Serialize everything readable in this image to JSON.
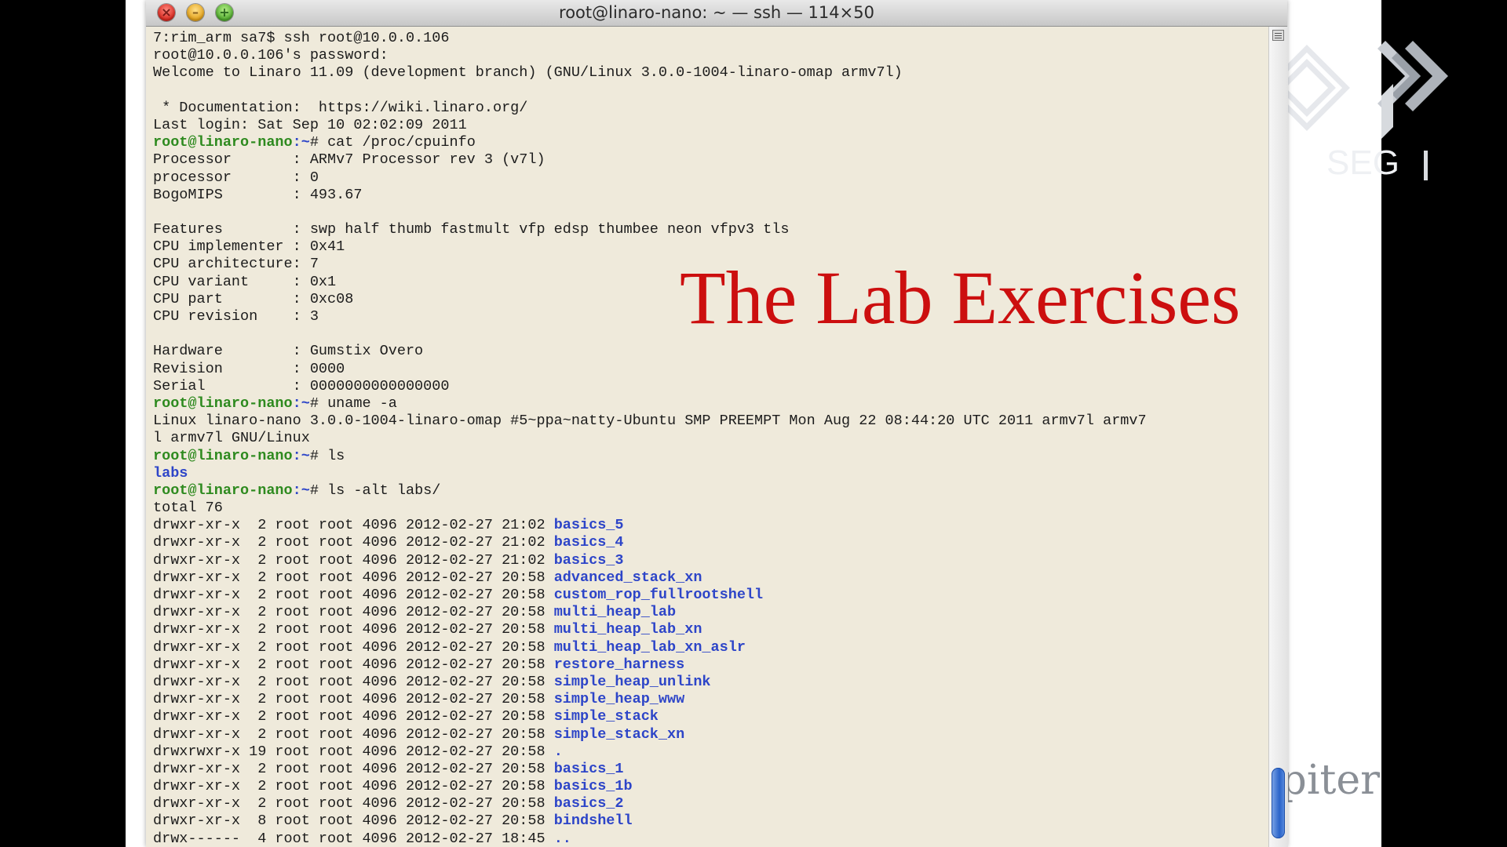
{
  "window": {
    "title": "root@linaro-nano: ~ — ssh — 114×50",
    "buttons": {
      "close": "×",
      "minimize": "–",
      "zoom": "+"
    }
  },
  "overlay": {
    "title": "The Lab Exercises"
  },
  "brand": {
    "footer_text": "piter",
    "logo_icon": "seal-logo-icon"
  },
  "colors": {
    "terminal_bg": "#efeadb",
    "prompt_user": "#2e8a1f",
    "prompt_path": "#2d45c8",
    "directory": "#2d45c8",
    "overlay_title": "#cc0f0f",
    "scroll_thumb": "#2a63c9"
  },
  "terminal": {
    "prompt_user": "root@linaro-nano",
    "prompt_path": ":~",
    "lines": [
      {
        "type": "text",
        "text": "7:rim_arm sa7$ ssh root@10.0.0.106"
      },
      {
        "type": "text",
        "text": "root@10.0.0.106's password:"
      },
      {
        "type": "text",
        "text": "Welcome to Linaro 11.09 (development branch) (GNU/Linux 3.0.0-1004-linaro-omap armv7l)"
      },
      {
        "type": "text",
        "text": ""
      },
      {
        "type": "text",
        "text": " * Documentation:  https://wiki.linaro.org/"
      },
      {
        "type": "text",
        "text": "Last login: Sat Sep 10 02:02:09 2011"
      },
      {
        "type": "cmd",
        "cmd": "# cat /proc/cpuinfo"
      },
      {
        "type": "text",
        "text": "Processor       : ARMv7 Processor rev 3 (v7l)"
      },
      {
        "type": "text",
        "text": "processor       : 0"
      },
      {
        "type": "text",
        "text": "BogoMIPS        : 493.67"
      },
      {
        "type": "text",
        "text": ""
      },
      {
        "type": "text",
        "text": "Features        : swp half thumb fastmult vfp edsp thumbee neon vfpv3 tls"
      },
      {
        "type": "text",
        "text": "CPU implementer : 0x41"
      },
      {
        "type": "text",
        "text": "CPU architecture: 7"
      },
      {
        "type": "text",
        "text": "CPU variant     : 0x1"
      },
      {
        "type": "text",
        "text": "CPU part        : 0xc08"
      },
      {
        "type": "text",
        "text": "CPU revision    : 3"
      },
      {
        "type": "text",
        "text": ""
      },
      {
        "type": "text",
        "text": "Hardware        : Gumstix Overo"
      },
      {
        "type": "text",
        "text": "Revision        : 0000"
      },
      {
        "type": "text",
        "text": "Serial          : 0000000000000000"
      },
      {
        "type": "cmd",
        "cmd": "# uname -a"
      },
      {
        "type": "text",
        "text": "Linux linaro-nano 3.0.0-1004-linaro-omap #5~ppa~natty-Ubuntu SMP PREEMPT Mon Aug 22 08:44:20 UTC 2011 armv7l armv7"
      },
      {
        "type": "text",
        "text": "l armv7l GNU/Linux"
      },
      {
        "type": "cmd",
        "cmd": "# ls"
      },
      {
        "type": "dironly",
        "name": "labs"
      },
      {
        "type": "cmd",
        "cmd": "# ls -alt labs/"
      },
      {
        "type": "text",
        "text": "total 76"
      },
      {
        "type": "entry",
        "perms": "drwxr-xr-x  2 root root 4096 2012-02-27 21:02 ",
        "name": "basics_5"
      },
      {
        "type": "entry",
        "perms": "drwxr-xr-x  2 root root 4096 2012-02-27 21:02 ",
        "name": "basics_4"
      },
      {
        "type": "entry",
        "perms": "drwxr-xr-x  2 root root 4096 2012-02-27 21:02 ",
        "name": "basics_3"
      },
      {
        "type": "entry",
        "perms": "drwxr-xr-x  2 root root 4096 2012-02-27 20:58 ",
        "name": "advanced_stack_xn"
      },
      {
        "type": "entry",
        "perms": "drwxr-xr-x  2 root root 4096 2012-02-27 20:58 ",
        "name": "custom_rop_fullrootshell"
      },
      {
        "type": "entry",
        "perms": "drwxr-xr-x  2 root root 4096 2012-02-27 20:58 ",
        "name": "multi_heap_lab"
      },
      {
        "type": "entry",
        "perms": "drwxr-xr-x  2 root root 4096 2012-02-27 20:58 ",
        "name": "multi_heap_lab_xn"
      },
      {
        "type": "entry",
        "perms": "drwxr-xr-x  2 root root 4096 2012-02-27 20:58 ",
        "name": "multi_heap_lab_xn_aslr"
      },
      {
        "type": "entry",
        "perms": "drwxr-xr-x  2 root root 4096 2012-02-27 20:58 ",
        "name": "restore_harness"
      },
      {
        "type": "entry",
        "perms": "drwxr-xr-x  2 root root 4096 2012-02-27 20:58 ",
        "name": "simple_heap_unlink"
      },
      {
        "type": "entry",
        "perms": "drwxr-xr-x  2 root root 4096 2012-02-27 20:58 ",
        "name": "simple_heap_www"
      },
      {
        "type": "entry",
        "perms": "drwxr-xr-x  2 root root 4096 2012-02-27 20:58 ",
        "name": "simple_stack"
      },
      {
        "type": "entry",
        "perms": "drwxr-xr-x  2 root root 4096 2012-02-27 20:58 ",
        "name": "simple_stack_xn"
      },
      {
        "type": "entry",
        "perms": "drwxrwxr-x 19 root root 4096 2012-02-27 20:58 ",
        "name": "."
      },
      {
        "type": "entry",
        "perms": "drwxr-xr-x  2 root root 4096 2012-02-27 20:58 ",
        "name": "basics_1"
      },
      {
        "type": "entry",
        "perms": "drwxr-xr-x  2 root root 4096 2012-02-27 20:58 ",
        "name": "basics_1b"
      },
      {
        "type": "entry",
        "perms": "drwxr-xr-x  2 root root 4096 2012-02-27 20:58 ",
        "name": "basics_2"
      },
      {
        "type": "entry",
        "perms": "drwxr-xr-x  8 root root 4096 2012-02-27 20:58 ",
        "name": "bindshell"
      },
      {
        "type": "entry",
        "perms": "drwx------  4 root root 4096 2012-02-27 18:45 ",
        "name": ".."
      }
    ]
  }
}
